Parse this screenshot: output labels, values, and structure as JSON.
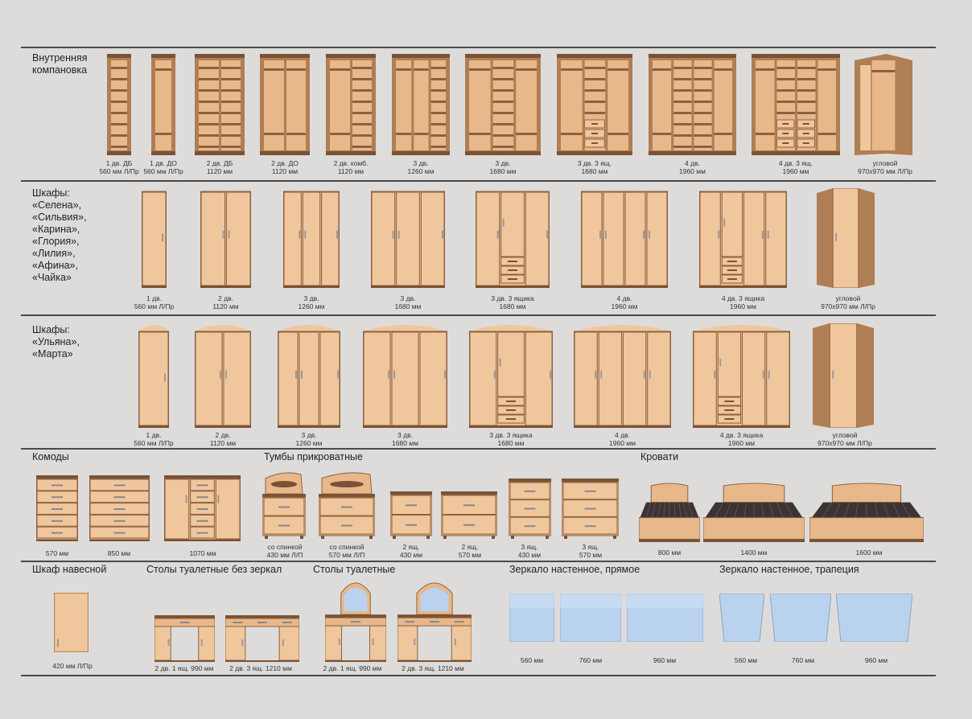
{
  "sections": {
    "interior": "Внутренняя\nкомпановка",
    "wardrobes_a": "Шкафы:\n«Селена»,\n«Сильвия»,\n«Карина»,\n«Глория»,\n«Лилия»,\n«Афина»,\n«Чайка»",
    "wardrobes_b": "Шкафы:\n«Ульяна»,\n«Марта»",
    "dressers": "Комоды",
    "nightstands": "Тумбы прикроватные",
    "beds": "Кровати",
    "wall_cabinet": "Шкаф навесной",
    "tables_no_mirror": "Столы туалетные без зеркал",
    "tables": "Столы туалетные",
    "mirror_rect": "Зеркало настенное, прямое",
    "mirror_trap": "Зеркало настенное, трапеция"
  },
  "row1": [
    "1 дв. ДБ\n560 мм Л/Пр",
    "1 дв. ДО\n560 мм Л/Пр",
    "2 дв. ДБ\n1120 мм",
    "2 дв. ДО\n1120 мм",
    "2 дв. комб.\n1120 мм",
    "3 дв.\n1260 мм",
    "3 дв.\n1680 мм",
    "3 дв. 3 ящ.\n1680 мм",
    "4 дв.\n1960 мм",
    "4 дв. 3 ящ.\n1960 мм",
    "угловой\n970х970 мм Л/Пр"
  ],
  "row2": [
    "1 дв.\n560 мм Л/Пр",
    "2 дв.\n1120 мм",
    "3 дв.\n1260 мм",
    "3 дв.\n1680 мм",
    "3 дв. 3 ящика\n1680 мм",
    "4 дв.\n1960 мм",
    "4 дв. 3 ящика\n1960 мм",
    "угловой\n970х970 мм Л/Пр"
  ],
  "row3": [
    "1 дв.\n560 мм Л/Пр",
    "2 дв.\n1120 мм",
    "3 дв.\n1260 мм",
    "3 дв.\n1680 мм",
    "3 дв. 3 ящика\n1680 мм",
    "4 дв.\n1960 мм",
    "4 дв. 3 ящика\n1960 мм",
    "угловой\n970х970 мм Л/Пр"
  ],
  "dressers": [
    "570 мм",
    "850 мм",
    "1070 мм"
  ],
  "nightstands": [
    "со спинкой\n430 мм Л/П",
    "со спинкой\n570 мм Л/П",
    "2 ящ.\n430 мм",
    "2 ящ.\n570 мм",
    "3 ящ.\n430 мм",
    "3 ящ.\n570 мм"
  ],
  "beds": [
    "800 мм",
    "1400 мм",
    "1600 мм"
  ],
  "wall_cabinet": [
    "420 мм Л/Пр"
  ],
  "tables_no_mirror": [
    "2 дв. 1 ящ. 990 мм",
    "2 дв. 3 ящ. 1210 мм"
  ],
  "tables": [
    "2 дв. 1 ящ. 990 мм",
    "2 дв. 3 ящ. 1210 мм"
  ],
  "mirror_rect": [
    "560 мм",
    "760 мм",
    "960 мм"
  ],
  "mirror_trap": [
    "560 мм",
    "760 мм",
    "960 мм"
  ]
}
